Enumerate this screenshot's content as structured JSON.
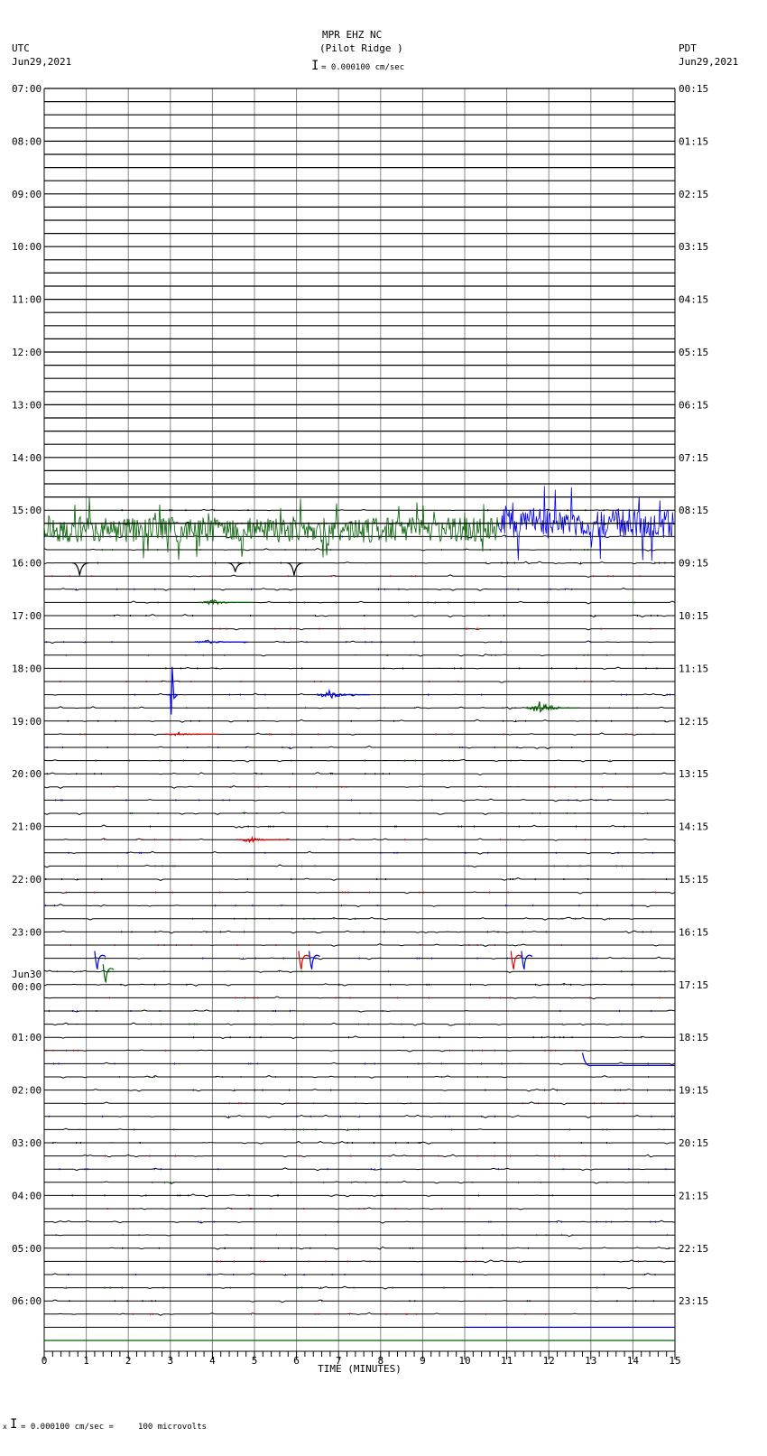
{
  "header": {
    "station": "MPR EHZ NC",
    "location": "(Pilot Ridge )",
    "left_tz": "UTC",
    "left_date": "Jun29,2021",
    "right_tz": "PDT",
    "right_date": "Jun29,2021",
    "scale": "= 0.000100 cm/sec"
  },
  "footer": {
    "scale": "= 0.000100 cm/sec =     100 microvolts",
    "prefix": "x"
  },
  "chart_data": {
    "type": "line",
    "title": "MPR EHZ NC (Pilot Ridge )",
    "xlabel": "TIME (MINUTES)",
    "xlim": [
      0,
      15
    ],
    "x_ticks": [
      "0",
      "1",
      "2",
      "3",
      "4",
      "5",
      "6",
      "7",
      "8",
      "9",
      "10",
      "11",
      "12",
      "13",
      "14",
      "15"
    ],
    "rows_per_hour": 4,
    "row_colors": [
      "#000000",
      "#e00000",
      "#0000e0",
      "#006000"
    ],
    "left_labels": [
      "07:00",
      "08:00",
      "09:00",
      "10:00",
      "11:00",
      "12:00",
      "13:00",
      "14:00",
      "15:00",
      "16:00",
      "17:00",
      "18:00",
      "19:00",
      "20:00",
      "21:00",
      "22:00",
      "23:00",
      "Jun30|00:00",
      "01:00",
      "02:00",
      "03:00",
      "04:00",
      "05:00",
      "06:00"
    ],
    "right_labels": [
      "00:15",
      "01:15",
      "02:15",
      "03:15",
      "04:15",
      "05:15",
      "06:15",
      "07:15",
      "08:15",
      "09:15",
      "10:15",
      "11:15",
      "12:15",
      "13:15",
      "14:15",
      "15:15",
      "16:15",
      "17:15",
      "18:15",
      "19:15",
      "20:15",
      "21:15",
      "22:15",
      "23:15"
    ],
    "blank_rows_before": 32,
    "noise_bursts": [
      {
        "row": 33.5,
        "start": 0,
        "end": 10.8,
        "amp": 20,
        "color": "#006000"
      },
      {
        "row": 33,
        "start": 10.8,
        "end": 15,
        "amp": 24,
        "color": "#0000e0"
      }
    ],
    "events": [
      {
        "row": 36,
        "minute": 0.8,
        "amp": 14,
        "type": "dip",
        "color": "#000000"
      },
      {
        "row": 36,
        "minute": 4.5,
        "amp": 10,
        "type": "dip",
        "color": "#000000"
      },
      {
        "row": 36,
        "minute": 5.9,
        "amp": 14,
        "type": "dip",
        "color": "#000000"
      },
      {
        "row": 39,
        "minute": 4.0,
        "amp": 3,
        "type": "burst",
        "color": "#006000"
      },
      {
        "row": 42,
        "minute": 3.9,
        "amp": 2,
        "type": "burst",
        "color": "#0000e0"
      },
      {
        "row": 46,
        "minute": 3.0,
        "amp": 22,
        "type": "spike",
        "color": "#0000e0"
      },
      {
        "row": 46,
        "minute": 6.8,
        "amp": 5,
        "type": "burst",
        "color": "#0000e0"
      },
      {
        "row": 47,
        "minute": 11.8,
        "amp": 8,
        "type": "burst",
        "color": "#006000"
      },
      {
        "row": 49,
        "minute": 3.2,
        "amp": 2,
        "type": "burst",
        "color": "#e00000"
      },
      {
        "row": 57,
        "minute": 4.9,
        "amp": 3,
        "type": "burst",
        "color": "#e00000"
      },
      {
        "row": 66,
        "minute": 6.05,
        "amp": 12,
        "type": "pulse",
        "color": "#e00000"
      },
      {
        "row": 66,
        "minute": 11.1,
        "amp": 12,
        "type": "pulse",
        "color": "#e00000"
      },
      {
        "row": 66,
        "minute": 1.2,
        "amp": 12,
        "type": "pulse",
        "color": "#0000e0"
      },
      {
        "row": 66,
        "minute": 6.3,
        "amp": 12,
        "type": "pulse",
        "color": "#0000e0"
      },
      {
        "row": 66,
        "minute": 11.35,
        "amp": 12,
        "type": "pulse",
        "color": "#0000e0"
      },
      {
        "row": 67,
        "minute": 1.4,
        "amp": 12,
        "type": "pulse",
        "color": "#006000"
      },
      {
        "row": 74,
        "minute": 12.8,
        "amp": 0,
        "type": "step",
        "color": "#0000e0"
      }
    ],
    "last_trace_row": 95
  }
}
